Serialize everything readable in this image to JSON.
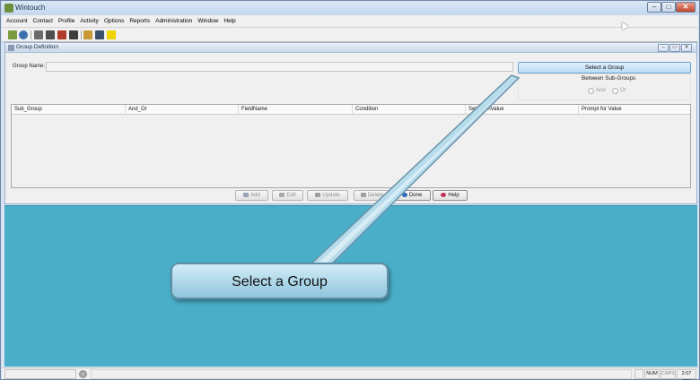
{
  "window": {
    "title": "Wintouch",
    "minimize_glyph": "–",
    "maximize_glyph": "□",
    "close_glyph": "✕"
  },
  "menu": [
    "Account",
    "Contact",
    "Profile",
    "Activity",
    "Options",
    "Reports",
    "Administration",
    "Window",
    "Help"
  ],
  "toolbar": {
    "icons": [
      "people-icon",
      "user-icon",
      "address-book-icon",
      "calendar-icon",
      "notebook-icon",
      "checklist-icon",
      "folder-icon",
      "window-layout-icon",
      "note-icon"
    ]
  },
  "group_definition": {
    "title": "Group Definition",
    "restore_glyph": "▭",
    "group_name_label": "Group Name:",
    "group_name_value": "",
    "select_group_label": "Select a Group",
    "between_subgroups_label": "Between Sub-Groups",
    "radio_and": "And",
    "radio_or": "Or",
    "columns": [
      "Sub_Group",
      "And_Or",
      "FieldName",
      "Condition",
      "SelectionValue",
      "Prompt for Value"
    ],
    "buttons": {
      "add": "Add",
      "edit": "Edit",
      "update": "Update",
      "delete": "Delete",
      "done": "Done",
      "help": "Help"
    }
  },
  "status_bar": {
    "num": "NUM",
    "caps": "CAPS",
    "time": "2:07 PM"
  },
  "callout": {
    "text": "Select a Group"
  },
  "colors": {
    "desktop": "#4aaec8",
    "callout_fill": "#a3d3e8",
    "select_button": "#c7e4f8"
  }
}
